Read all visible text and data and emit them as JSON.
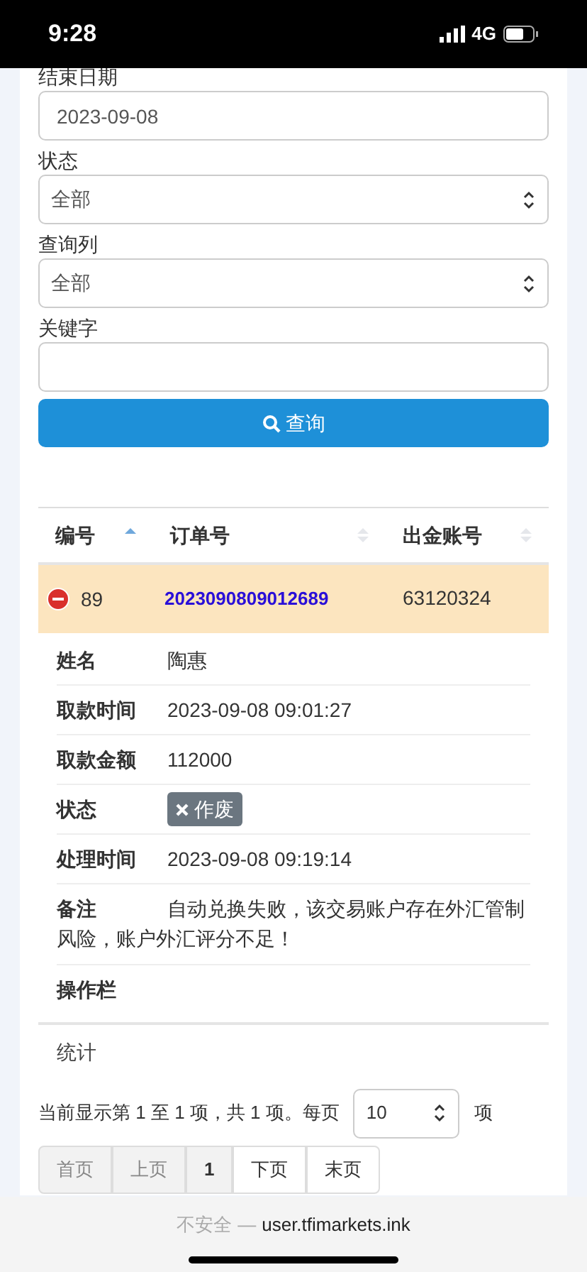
{
  "status_bar": {
    "time": "9:28",
    "network": "4G"
  },
  "form": {
    "fields": [
      {
        "label": "结束日期",
        "kind": "input",
        "value": "2023-09-08"
      },
      {
        "label": "状态",
        "kind": "select",
        "value": "全部"
      },
      {
        "label": "查询列",
        "kind": "select",
        "value": "全部"
      },
      {
        "label": "关键字",
        "kind": "input"
      }
    ],
    "search_button": "查询"
  },
  "table": {
    "columns": [
      {
        "label": "编号",
        "sorted": true
      },
      {
        "label": "订单号",
        "sorted": false
      },
      {
        "label": "出金账号",
        "sorted": false
      }
    ],
    "rows": [
      {
        "selected": true,
        "expanded": true,
        "cells": [
          "89",
          "2023090809012689",
          "63120324"
        ],
        "details": [
          {
            "label": "姓名",
            "kind": "text",
            "value": "陶惠"
          },
          {
            "label": "取款时间",
            "kind": "text",
            "value": "2023-09-08 09:01:27"
          },
          {
            "label": "取款金额",
            "kind": "text",
            "value": "112000"
          },
          {
            "label": "状态",
            "kind": "badge",
            "value": "作废"
          },
          {
            "label": "处理时间",
            "kind": "text",
            "value": "2023-09-08 09:19:14"
          },
          {
            "label": "备注",
            "kind": "note",
            "value": "自动兑换失败，该交易账户存在外汇管制风险，账户外汇评分不足！"
          },
          {
            "label": "操作栏",
            "kind": "text"
          }
        ]
      }
    ],
    "footer": "统计"
  },
  "pagination": {
    "info": "当前显示第 1 至 1 项，共 1 项。每页",
    "page_size": "10",
    "suffix": "项",
    "pages": [
      {
        "label": "首页",
        "disabled": true,
        "selected": false
      },
      {
        "label": "上页",
        "disabled": true,
        "selected": false
      },
      {
        "label": "1",
        "disabled": false,
        "selected": true
      },
      {
        "label": "下页",
        "disabled": false,
        "selected": false
      },
      {
        "label": "末页",
        "disabled": false,
        "selected": false
      }
    ]
  },
  "browser_bar": {
    "security": "不安全",
    "separator": "—",
    "url": "user.tfimarkets.ink"
  }
}
